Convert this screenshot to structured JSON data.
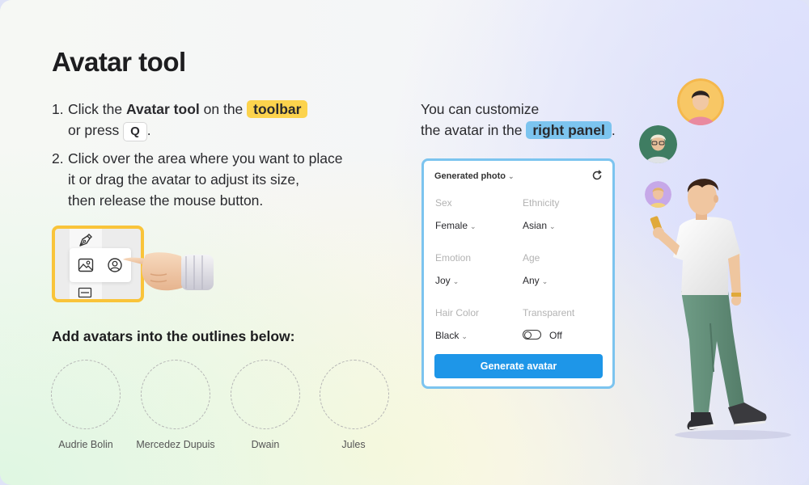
{
  "title": "Avatar tool",
  "steps": [
    {
      "num": "1.",
      "text_before": "Click the",
      "bold": "Avatar tool",
      "text_middle": "on the",
      "highlight": "toolbar",
      "line2": "or press",
      "key": "Q",
      "end": "."
    },
    {
      "num": "2.",
      "lines": [
        "Click over the area where you want to place",
        "it or drag the avatar to adjust its size,",
        "then release the mouse button."
      ]
    }
  ],
  "outlines": {
    "title": "Add avatars into the outlines below:",
    "names": [
      "Audrie Bolin",
      "Mercedez Dupuis",
      "Dwain",
      "Jules"
    ]
  },
  "right_text": {
    "line1": "You can customize",
    "line2": "the avatar in the",
    "highlight": "right panel",
    "end": "."
  },
  "panel": {
    "header": "Generated photo",
    "fields": {
      "sex": {
        "label": "Sex",
        "value": "Female"
      },
      "ethnicity": {
        "label": "Ethnicity",
        "value": "Asian"
      },
      "emotion": {
        "label": "Emotion",
        "value": "Joy"
      },
      "age": {
        "label": "Age",
        "value": "Any"
      },
      "hair_color": {
        "label": "Hair Color",
        "value": "Black"
      },
      "transparent": {
        "label": "Transparent",
        "value": "Off"
      }
    },
    "button": "Generate avatar"
  },
  "colors": {
    "highlight_yellow": "#fcd34d",
    "highlight_blue": "#7cc4ef",
    "button_blue": "#1e96e8",
    "toolbar_frame": "#f9c43a"
  }
}
